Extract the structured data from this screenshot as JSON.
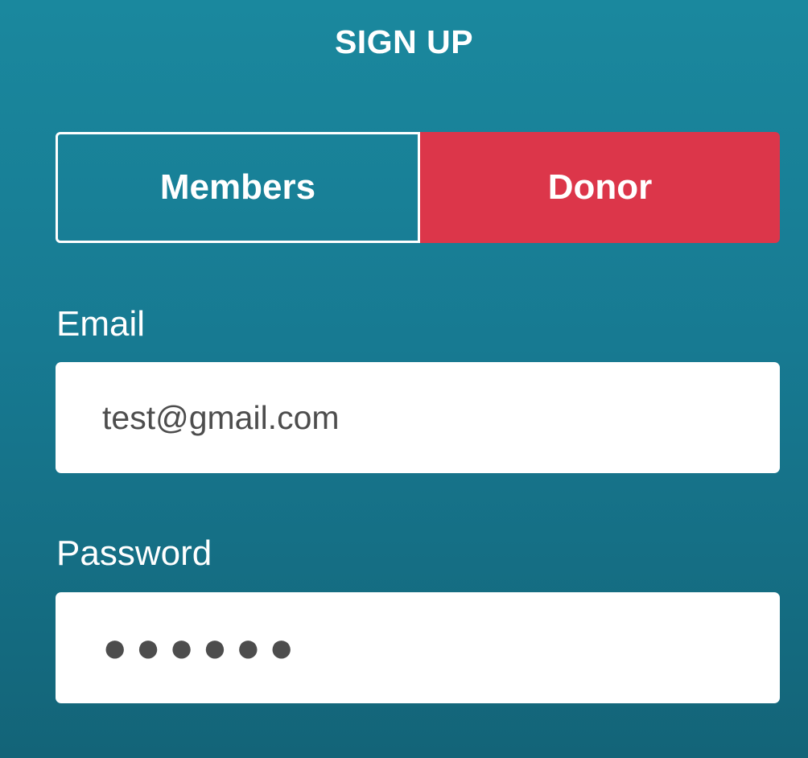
{
  "header": {
    "title": "SIGN UP"
  },
  "account_type_toggle": {
    "options": [
      {
        "label": "Members",
        "selected": false
      },
      {
        "label": "Donor",
        "selected": true
      }
    ]
  },
  "form": {
    "email": {
      "label": "Email",
      "value": "test@gmail.com"
    },
    "password": {
      "label": "Password",
      "masked_value": "●●●●●●"
    }
  },
  "colors": {
    "background_top": "#1a889e",
    "background_bottom": "#136478",
    "accent_selected": "#dc364a",
    "text_light": "#ffffff",
    "input_text": "#4d4d4d"
  }
}
